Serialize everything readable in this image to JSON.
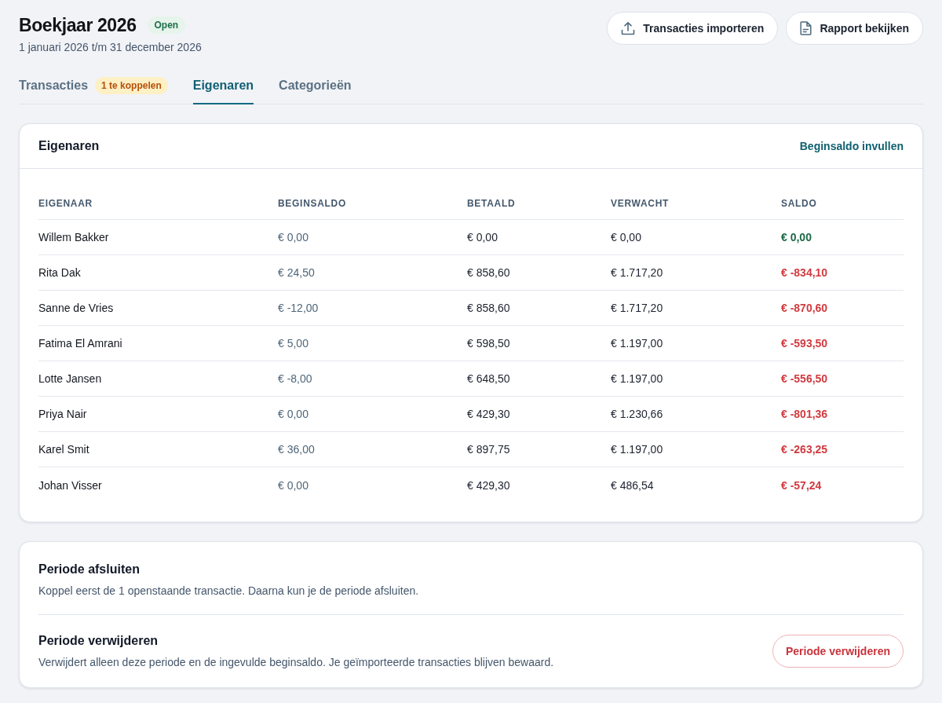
{
  "header": {
    "title": "Boekjaar 2026",
    "status": "Open",
    "period": "1 januari 2026 t/m 31 december 2026",
    "actions": [
      {
        "label": "Transacties importeren",
        "kind": "import"
      },
      {
        "label": "Rapport bekijken",
        "kind": "report"
      }
    ]
  },
  "tabs": [
    {
      "label": "Transacties",
      "badge": "1 te koppelen",
      "selected": false
    },
    {
      "label": "Eigenaren",
      "selected": true
    },
    {
      "label": "Categorieën",
      "selected": false
    }
  ],
  "owners_card": {
    "title": "Eigenaren",
    "action": "Beginsaldo invullen",
    "table": {
      "columns": [
        "EIGENAAR",
        "BEGINSALDO",
        "BETAALD",
        "VERWACHT",
        "SALDO"
      ],
      "rows": [
        {
          "owner": "Willem Bakker",
          "beginsaldo": "€ 0,00",
          "betaald": "€ 0,00",
          "verwacht": "€ 0,00",
          "saldo": {
            "value": "€ 0,00",
            "kind": "settled"
          }
        },
        {
          "owner": "Rita Dak",
          "beginsaldo": "€ 24,50",
          "betaald": "€ 858,60",
          "verwacht": "€ 1.717,20",
          "saldo": {
            "value": "€ -834,10",
            "kind": "owed"
          }
        },
        {
          "owner": "Sanne de Vries",
          "beginsaldo": "€ -12,00",
          "betaald": "€ 858,60",
          "verwacht": "€ 1.717,20",
          "saldo": {
            "value": "€ -870,60",
            "kind": "owed"
          }
        },
        {
          "owner": "Fatima El Amrani",
          "beginsaldo": "€ 5,00",
          "betaald": "€ 598,50",
          "verwacht": "€ 1.197,00",
          "saldo": {
            "value": "€ -593,50",
            "kind": "owed"
          }
        },
        {
          "owner": "Lotte Jansen",
          "beginsaldo": "€ -8,00",
          "betaald": "€ 648,50",
          "verwacht": "€ 1.197,00",
          "saldo": {
            "value": "€ -556,50",
            "kind": "owed"
          }
        },
        {
          "owner": "Priya Nair",
          "beginsaldo": "€ 0,00",
          "betaald": "€ 429,30",
          "verwacht": "€ 1.230,66",
          "saldo": {
            "value": "€ -801,36",
            "kind": "owed"
          }
        },
        {
          "owner": "Karel Smit",
          "beginsaldo": "€ 36,00",
          "betaald": "€ 897,75",
          "verwacht": "€ 1.197,00",
          "saldo": {
            "value": "€ -263,25",
            "kind": "owed"
          }
        },
        {
          "owner": "Johan Visser",
          "beginsaldo": "€ 0,00",
          "betaald": "€ 429,30",
          "verwacht": "€ 486,54",
          "saldo": {
            "value": "€ -57,24",
            "kind": "owed"
          }
        }
      ]
    }
  },
  "period_card": {
    "sections": [
      {
        "title": "Periode afsluiten",
        "description": "Koppel eerst de 1 openstaande transactie. Daarna kun je de periode afsluiten."
      },
      {
        "title": "Periode verwijderen",
        "description": "Verwijdert alleen deze periode en de ingevulde beginsaldo. Je geïmporteerde transacties blijven bewaard.",
        "action": {
          "label": "Periode verwijderen",
          "kind": "danger"
        }
      }
    ]
  }
}
